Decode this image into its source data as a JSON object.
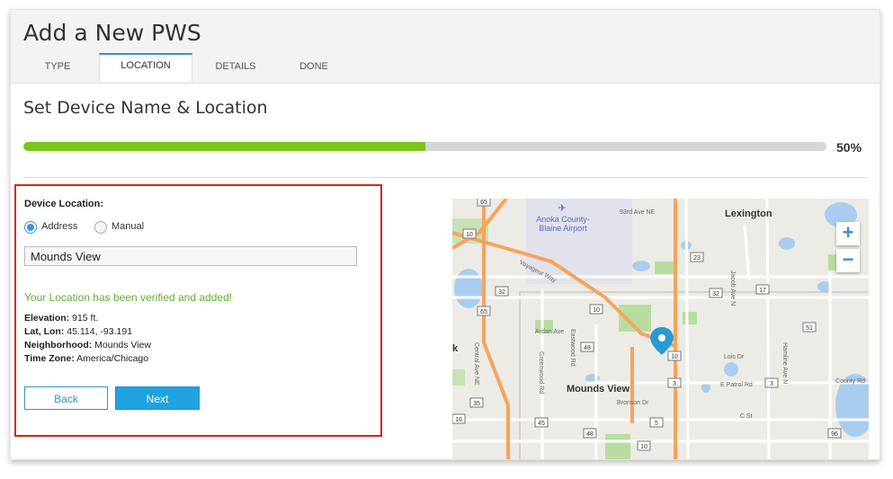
{
  "page": {
    "title": "Add a New PWS"
  },
  "tabs": [
    {
      "label": "TYPE"
    },
    {
      "label": "LOCATION",
      "active": true
    },
    {
      "label": "DETAILS"
    },
    {
      "label": "DONE"
    }
  ],
  "section": {
    "title": "Set Device Name & Location"
  },
  "progress": {
    "value": 0.5,
    "label": "50%"
  },
  "form": {
    "device_location_label": "Device Location:",
    "options": [
      {
        "label": "Address",
        "selected": true
      },
      {
        "label": "Manual",
        "selected": false
      }
    ],
    "address_value": "Mounds View",
    "verified_message": "Your Location has been verified and added!",
    "details": [
      {
        "label": "Elevation:",
        "value": " 915 ft."
      },
      {
        "label": "Lat, Lon:",
        "value": " 45.114, -93.191"
      },
      {
        "label": "Neighborhood:",
        "value": " Mounds View"
      },
      {
        "label": "Time Zone:",
        "value": " America/Chicago"
      }
    ],
    "back_label": "Back",
    "next_label": "Next"
  },
  "map": {
    "zoom_in": "+",
    "zoom_out": "−",
    "places": {
      "lexington": "Lexington",
      "anoka_airport_1": "Anoka County-",
      "anoka_airport_2": "Blaine Airport",
      "mounds_view": "Mounds View",
      "k": "k"
    },
    "roads": {
      "r93rd": "93rd Ave NE",
      "voyageur": "Voyageur Way",
      "ardan": "Ardan Ave",
      "eastwood": "Eastwood Rd",
      "greenwood": "Greenwood Rd",
      "central": "Central Ave NE",
      "bronson": "Bronson Dr",
      "lois": "Lois Dr",
      "e_patrol": "E Patrol Rd",
      "county_rd": "County Rd",
      "c_st": "C St",
      "hamline": "Hamline Ave N",
      "jacob": "Jacob Ave N"
    },
    "shields": {
      "s65a": "65",
      "s10a": "10",
      "s32a": "32",
      "s65b": "65",
      "s10b": "10",
      "s23": "23",
      "s32b": "32",
      "s17": "17",
      "s48a": "48",
      "s51": "51",
      "s10c": "10",
      "s3a": "3",
      "s3b": "3",
      "s35": "35",
      "s10d": "10",
      "s5": "5",
      "s45": "45",
      "s48b": "48",
      "s10e": "10",
      "s96": "96"
    },
    "colors": {
      "highway": "#f7a35c",
      "road": "#ffffff",
      "water": "#a9cdee",
      "park": "#b7dea0",
      "pin": "#2a9ad4"
    }
  }
}
